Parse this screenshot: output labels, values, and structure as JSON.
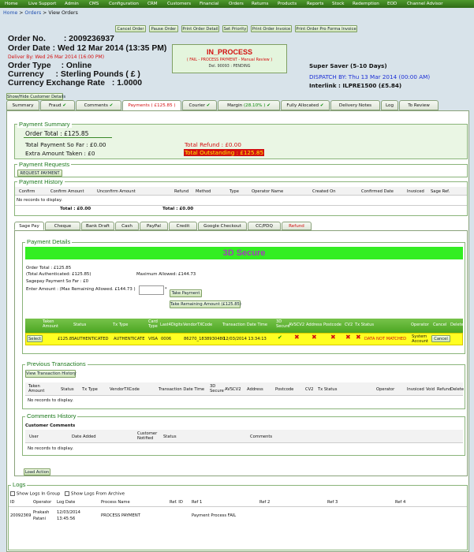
{
  "topnav": [
    "Home",
    "Live Support",
    "Admin",
    "CMS",
    "Configuration",
    "CRM",
    "Customers",
    "Financial",
    "Orders",
    "Returns",
    "Products",
    "Reports",
    "Stock",
    "Redemption",
    "EOD",
    "Channel Advisor"
  ],
  "breadcrumb": {
    "home": "Home",
    "sep1": " > ",
    "orders": "Orders",
    "sep2": " > ",
    "current": "View Orders"
  },
  "actions": [
    "Cancel Order",
    "Pause Order",
    "Print Order Detail",
    "Set Priority",
    "Print Order Invoice",
    "Print Order Pro Forma Invoice"
  ],
  "order": {
    "no_label": "Order No.",
    "no": ": 2009236937",
    "date_label": "Order Date",
    "date": ": Wed 12 Mar 2014 (13:35 PM)",
    "deliver_by": "Deliver By: Wed 26 Mar 2014 (16:00 PM)",
    "type_label": "Order Type",
    "type": ": Online",
    "currency_label": "Currency",
    "currency": ": Sterling Pounds ( £ )",
    "rate_label": "Currency Exchange Rate",
    "rate": ": 1.0000"
  },
  "status_box": {
    "title": "IN_PROCESS",
    "sub": "( FAIL - PROCESS PAYMENT - Manual Review )",
    "del": "Del. 90093 : PENDING"
  },
  "shipping": {
    "service": "Super Saver (5-10 Days)",
    "dispatch": "DISPATCH BY:  Thu 13 Mar 2014 (00:00 AM)",
    "interlink": "Interlink : ILPRE1500 (£5.84)"
  },
  "toggle_button": "Show/Hide Customer Details",
  "tabs": [
    "Summary",
    "Fraud",
    "Comments",
    "Payments ( £125.85 )",
    "Courier",
    "Margin",
    "Fully Allocated",
    "Delivery Notes",
    "Log",
    "To Review"
  ],
  "margin_pct": "(28.10% )",
  "payment_summary": {
    "title": "Payment Summary",
    "order_total": "Order Total : £125.85",
    "paid": "Total Payment So Far : £0.00",
    "extra": "Extra Amount Taken : £0",
    "refund": "Total Refund : £0.00",
    "outstanding": "Total Outstanding : £125.85"
  },
  "payment_requests": {
    "title": "Payment Requests",
    "button": "REQUEST PAYMENT"
  },
  "payment_history": {
    "title": "Payment History",
    "columns": [
      "Confirm",
      "Confirm Amount",
      "Unconfirm Amount",
      "Refund",
      "Method",
      "Type",
      "Operator Name",
      "Created On",
      "Confirmed Date",
      "Invoiced",
      "Sage Ref."
    ],
    "empty": "No records to display.",
    "total_confirm": "Total : £0.00",
    "total_refund": "Total : £0.00"
  },
  "method_tabs": [
    "Sage Pay",
    "Cheque",
    "Bank Draft",
    "Cash",
    "PayPal",
    "Credit",
    "Google Checkout",
    "CC/PDQ",
    "Refund"
  ],
  "payment_details": {
    "title": "Payment Details",
    "banner": "3D Secure",
    "order_total": "Order Total : £125.85",
    "authenticated": "(Total Authenticated: £125.85)",
    "max_allowed": "Maximum Allowed: £144.73",
    "sagepay_paid": "Sagepay Payment So Far : £0",
    "enter_amount": "Enter Amount : (Max Remaining Allowed. £144.73 )",
    "amount_value": "",
    "take_payment": "Take Payment",
    "take_remaining": "Take Remaining Amount (£125.85)",
    "columns": [
      "Taken Amount",
      "Status",
      "Tx Type",
      "Card Type",
      "Last4Digits",
      "VendorTXCode",
      "Transaction Date Time",
      "3D Secure",
      "AVSCV2",
      "Address",
      "Postcode",
      "CV2",
      "Tx Status",
      "Operator",
      "Cancel",
      "Delete"
    ],
    "row": {
      "select": "Select",
      "amount": "£125.85",
      "status": "AUTHENTICATED",
      "tx_type": "AUTHENTICATE",
      "card": "VISA",
      "last4": "0006",
      "vendor": "86270_1838930480",
      "datetime": "12/03/2014 13:34:13",
      "tx_status": "DATA NOT MATCHED",
      "operator": "System Account",
      "cancel": "Cancel"
    }
  },
  "previous_transactions": {
    "title": "Previous Transactions",
    "button": "View Transaction History",
    "columns": [
      "Taken Amount",
      "Status",
      "Tx Type",
      "VendorTXCode",
      "Transaction Date Time",
      "3D Secure",
      "AVSCV2",
      "Address",
      "Postcode",
      "CV2",
      "Tx Status",
      "Operator",
      "Invoiced",
      "Void",
      "Refund",
      "Delete"
    ],
    "empty": "No records to display."
  },
  "comments_history": {
    "title": "Comments History",
    "sub": "Customer Comments",
    "columns": [
      "User",
      "Date Added",
      "Customer Notified",
      "Status",
      "Comments"
    ],
    "empty": "No records to display."
  },
  "load_action": "Load Action",
  "logs": {
    "title": "Logs",
    "cb1": "Show Logs In Group",
    "cb2": "Show Logs From Archive",
    "columns": [
      "ID",
      "Operator",
      "Log Date",
      "Process Name",
      "Ref. ID",
      "Ref 1",
      "Ref 2",
      "Ref 3",
      "Ref 4"
    ],
    "row": {
      "id": "20092369",
      "operator": "Prakash Patani",
      "date": "12/03/2014 13:45:56",
      "process": "PROCESS PAYMENT",
      "ref1": "Payment Process FAIL"
    }
  },
  "colors": {
    "nav": "#3a7f20",
    "section": "#1e7a1e",
    "danger": "#d31010",
    "banner": "#33ee22",
    "highlight": "#ffff22"
  }
}
